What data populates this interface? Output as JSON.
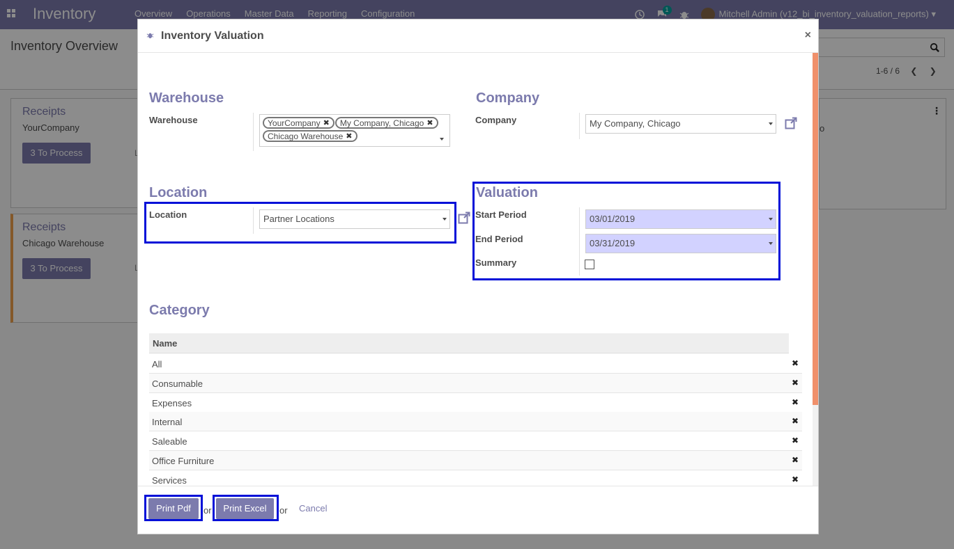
{
  "navbar": {
    "app_name": "Inventory",
    "menus": [
      "Overview",
      "Operations",
      "Master Data",
      "Reporting",
      "Configuration"
    ],
    "chat_count": "1",
    "user": "Mitchell Admin (v12_bi_inventory_valuation_reports)"
  },
  "control_panel": {
    "title": "Inventory Overview",
    "pager": "1-6 / 6"
  },
  "cards": [
    {
      "title": "Receipts",
      "subtitle": "YourCompany",
      "button": "3 To Process"
    },
    {
      "title": "Receipts",
      "subtitle": "Chicago Warehouse",
      "button": "3 To Process"
    }
  ],
  "background_fragments": {
    "card1_trunc": "L",
    "card2_trunc": "L",
    "right_card_trunc": "o",
    "right_card_menu": "⋮"
  },
  "modal": {
    "title": "Inventory Valuation",
    "close": "×",
    "warehouse_section": "Warehouse",
    "warehouse_label": "Warehouse",
    "warehouse_tags": [
      "YourCompany",
      "My Company, Chicago",
      "Chicago Warehouse"
    ],
    "company_section": "Company",
    "company_label": "Company",
    "company_value": "My Company, Chicago",
    "location_section": "Location",
    "location_label": "Location",
    "location_value": "Partner Locations",
    "valuation_section": "Valuation",
    "start_label": "Start Period",
    "start_value": "03/01/2019",
    "end_label": "End Period",
    "end_value": "03/31/2019",
    "summary_label": "Summary",
    "summary_checked": false,
    "category_section": "Category",
    "category_header": "Name",
    "categories": [
      "All",
      "Consumable",
      "Expenses",
      "Internal",
      "Saleable",
      "Office Furniture",
      "Services"
    ],
    "delete_glyph": "✖"
  },
  "footer": {
    "print_pdf": "Print Pdf",
    "or1": "or",
    "print_excel": "Print Excel",
    "or2": "or",
    "cancel": "Cancel"
  },
  "colors": {
    "brand": "#7c7bad",
    "highlight": "#0010d8",
    "scrollbar": "#f0906b",
    "date_bg": "#d2d2ff"
  }
}
